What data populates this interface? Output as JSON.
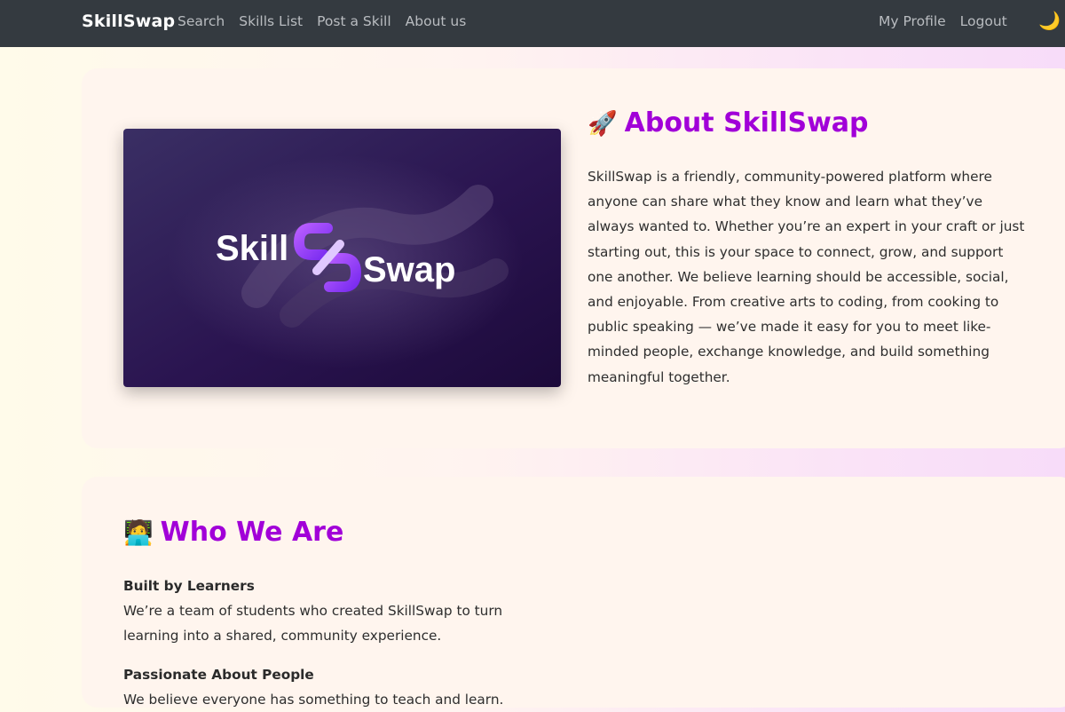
{
  "nav": {
    "brand": "SkillSwap",
    "links_left": [
      "Search",
      "Skills List",
      "Post a Skill",
      "About us"
    ],
    "links_right": [
      "My Profile",
      "Logout"
    ],
    "theme_icon": "moon-icon",
    "theme_glyph": "🌙"
  },
  "about": {
    "emoji": "🚀",
    "title": "About SkillSwap",
    "text": "SkillSwap is a friendly, community-powered platform where anyone can share what they know and learn what they’ve always wanted to. Whether you’re an expert in your craft or just starting out, this is your space to connect, grow, and support one another. We believe learning should be accessible, social, and enjoyable. From creative arts to coding, from cooking to public speaking — we’ve made it easy for you to meet like-minded people, exchange knowledge, and build something meaningful together.",
    "image": {
      "logo_left": "Skill",
      "logo_right": "Swap"
    }
  },
  "who": {
    "emoji": "🧑‍💻",
    "title": "Who We Are",
    "blocks": [
      {
        "heading": "Built by Learners",
        "text": "We’re a team of students who created SkillSwap to turn learning into a shared, community experience."
      },
      {
        "heading": "Passionate About People",
        "text": "We believe everyone has something to teach and learn."
      }
    ]
  },
  "colors": {
    "navbar": "#343a40",
    "accent": "#a100d8",
    "card": "#fff5ee"
  }
}
